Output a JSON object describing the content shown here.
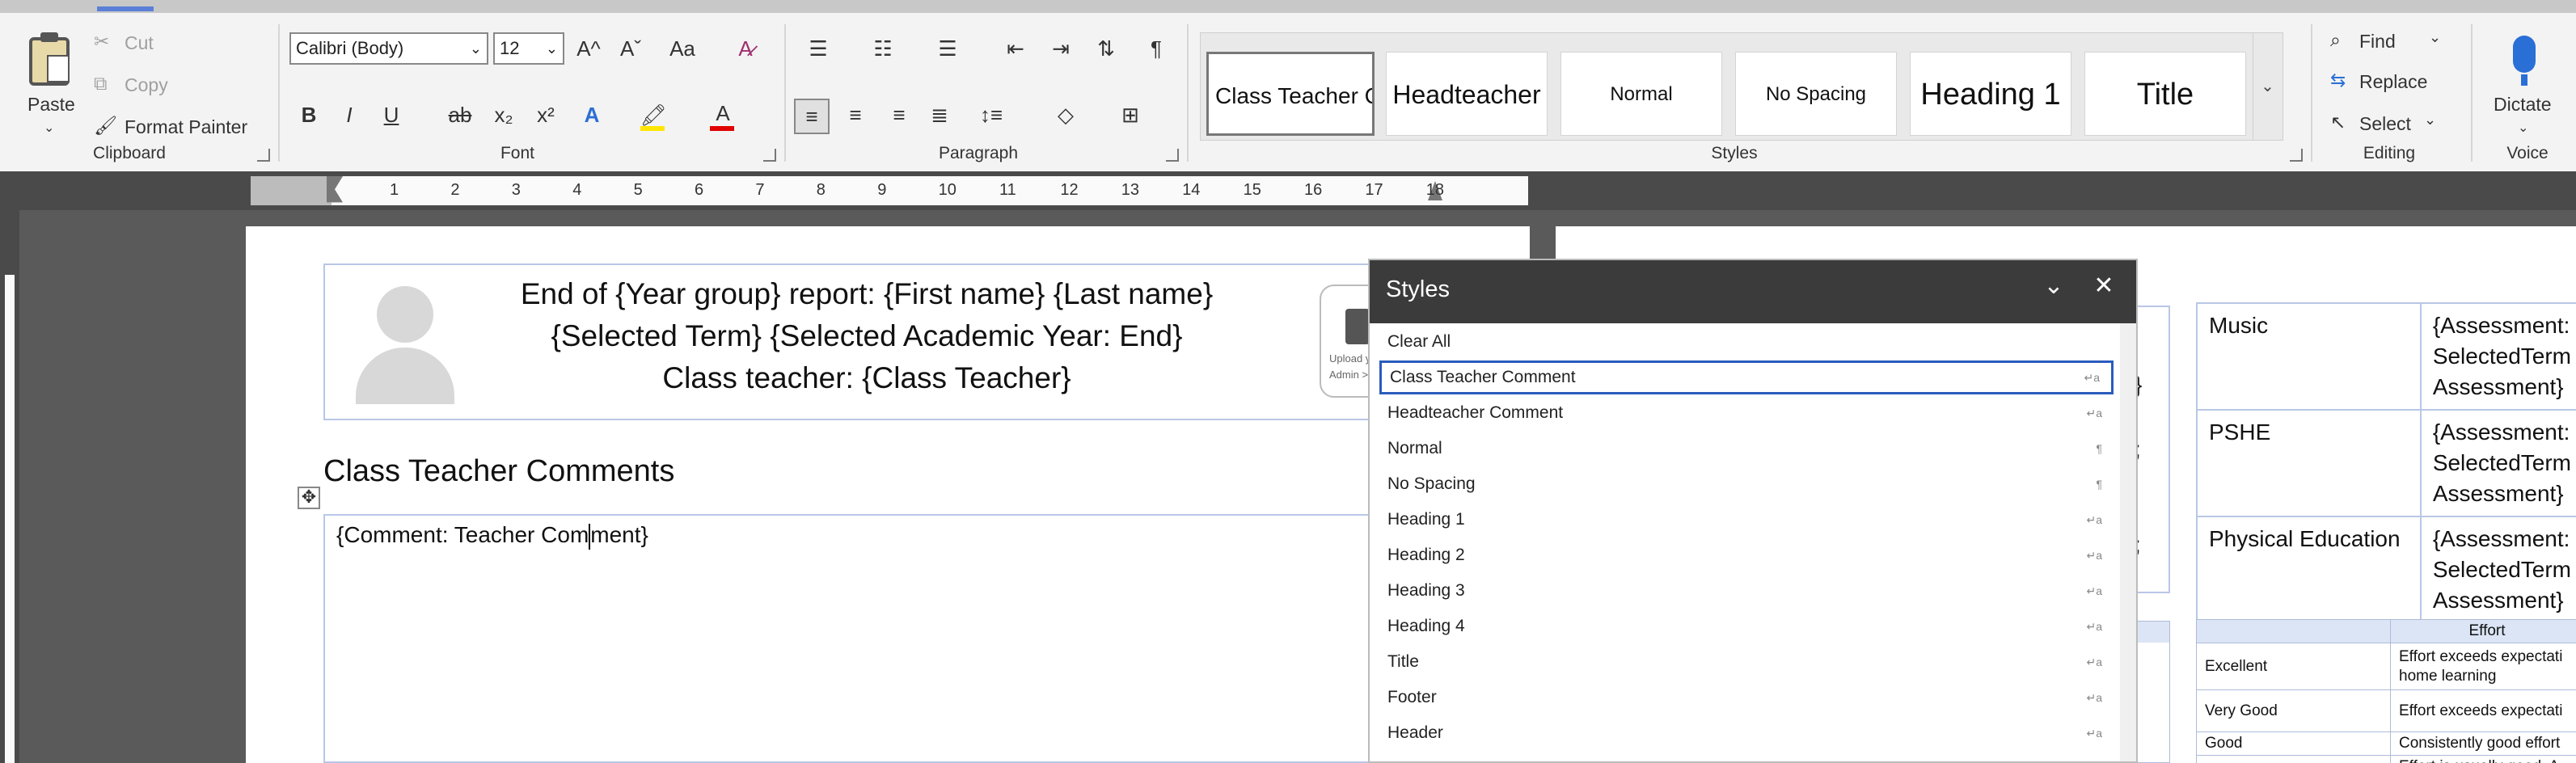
{
  "ribbon": {
    "clipboard": {
      "group_label": "Clipboard",
      "paste": "Paste",
      "cut": "Cut",
      "copy": "Copy",
      "format_painter": "Format Painter"
    },
    "font": {
      "group_label": "Font",
      "font_name": "Calibri (Body)",
      "font_size": "12",
      "grow": "A^",
      "shrink": "Aˇ",
      "change_case": "Aa",
      "bold": "B",
      "italic": "I",
      "underline": "U",
      "strike": "ab",
      "subscript": "x₂",
      "superscript": "x²",
      "text_effects": "A",
      "font_color": "A"
    },
    "paragraph": {
      "group_label": "Paragraph"
    },
    "styles": {
      "group_label": "Styles",
      "gallery": [
        "Class Teacher C",
        "Headteacher",
        "Normal",
        "No Spacing",
        "Heading 1",
        "Title"
      ]
    },
    "editing": {
      "group_label": "Editing",
      "find": "Find",
      "replace": "Replace",
      "select": "Select"
    },
    "voice": {
      "group_label": "Voice",
      "dictate": "Dictate"
    }
  },
  "ruler": {
    "numbers": [
      "1",
      "2",
      "3",
      "4",
      "5",
      "6",
      "7",
      "8",
      "9",
      "10",
      "11",
      "12",
      "13",
      "14",
      "15",
      "16",
      "17",
      "18"
    ]
  },
  "document": {
    "header_line1": "End of {Year group} report: {First name} {Last name}",
    "header_line2": "{Selected Term} {Selected Academic Year: End}",
    "header_line3": "Class teacher: {Class Teacher}",
    "upload_text_1": "Upload y",
    "upload_text_2": "Admin >",
    "section_heading": "Class Teacher Comments",
    "comment_placeholder_a": "{Comment: Teacher Com",
    "comment_placeholder_b": "ment}"
  },
  "subjects": [
    {
      "name": "Music",
      "line1": "{Assessment:",
      "line2": "SelectedTerm",
      "line3": "Assessment}"
    },
    {
      "name": "PSHE",
      "line1": "{Assessment:",
      "line2": "SelectedTerm",
      "line3": "Assessment}"
    },
    {
      "name": "Physical Education",
      "line1": "{Assessment:",
      "line2": "SelectedTerm",
      "line3": "Assessment}"
    }
  ],
  "behind_fragments": [
    "}",
    ";",
    ";",
    "p"
  ],
  "effort": {
    "header": "Effort",
    "rows": [
      {
        "grade": "Excellent",
        "desc1": "Effort exceeds expectati",
        "desc2": "home learning"
      },
      {
        "grade": "Very Good",
        "desc1": "Effort exceeds expectati",
        "desc2": ""
      },
      {
        "grade": "Good",
        "desc1": "Consistently good effort",
        "desc2": ""
      },
      {
        "grade": "",
        "desc1": "Effort is usually good. A",
        "desc2": ""
      }
    ]
  },
  "styles_pane": {
    "title": "Styles",
    "items": [
      {
        "label": "Clear All",
        "mark": ""
      },
      {
        "label": "Class Teacher Comment",
        "mark": "↵a"
      },
      {
        "label": "Headteacher Comment",
        "mark": "↵a"
      },
      {
        "label": "Normal",
        "mark": "¶"
      },
      {
        "label": "No Spacing",
        "mark": "¶"
      },
      {
        "label": "Heading 1",
        "mark": "↵a"
      },
      {
        "label": "Heading 2",
        "mark": "↵a"
      },
      {
        "label": "Heading 3",
        "mark": "↵a"
      },
      {
        "label": "Heading 4",
        "mark": "↵a"
      },
      {
        "label": "Title",
        "mark": "↵a"
      },
      {
        "label": "Footer",
        "mark": "↵a"
      },
      {
        "label": "Header",
        "mark": "↵a"
      }
    ]
  }
}
